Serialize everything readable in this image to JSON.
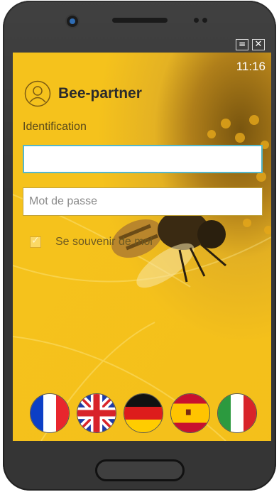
{
  "status": {
    "time": "11:16"
  },
  "window_controls": {
    "menu_icon": "menu-icon",
    "close_icon": "close-icon"
  },
  "header": {
    "title": "Bee-partner",
    "icon": "user-avatar-icon"
  },
  "login": {
    "identification_label": "Identification",
    "identification_value": "",
    "password_placeholder": "Mot de passe",
    "remember_label": "Se souvenir de moi",
    "remember_checked": true
  },
  "languages": [
    {
      "name": "fr",
      "icon": "france-flag-icon"
    },
    {
      "name": "en",
      "icon": "uk-flag-icon"
    },
    {
      "name": "de",
      "icon": "germany-flag-icon"
    },
    {
      "name": "es",
      "icon": "spain-flag-icon"
    },
    {
      "name": "it",
      "icon": "italy-flag-icon"
    }
  ],
  "colors": {
    "accent": "#f3c019",
    "title": "#2b2b2b",
    "input_focus": "#55b7c9"
  }
}
